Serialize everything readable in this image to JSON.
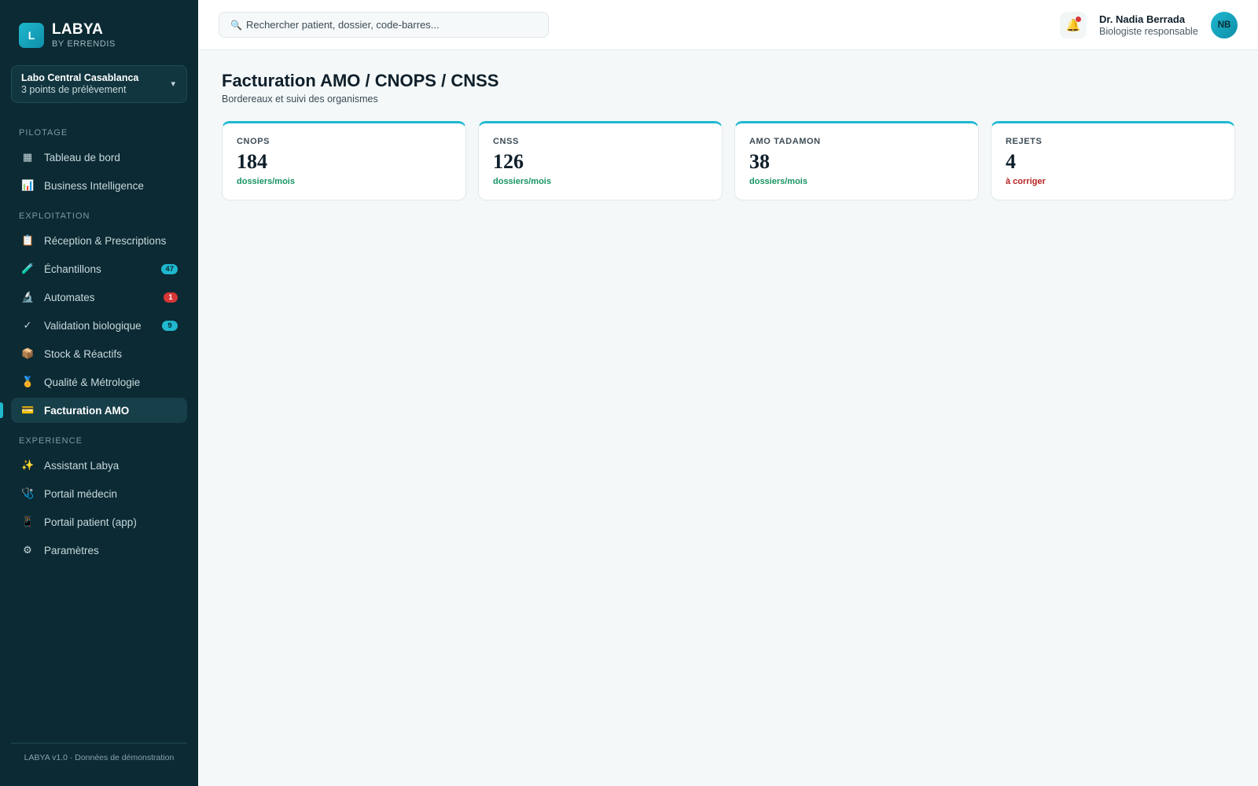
{
  "brand": {
    "logo_letter": "L",
    "name": "LABYA",
    "subtitle": "BY ERRENDIS"
  },
  "lab_selector": {
    "name": "Labo Central Casablanca",
    "subtitle": "3 points de prélèvement",
    "caret": "▾"
  },
  "sidebar": {
    "sections": [
      {
        "title": "PILOTAGE"
      },
      {
        "title": "EXPLOITATION"
      },
      {
        "title": "EXPERIENCE"
      }
    ],
    "items": [
      {
        "label": "Tableau de bord",
        "icon": "grid-icon",
        "glyph": "▦"
      },
      {
        "label": "Business Intelligence",
        "icon": "bar-chart-icon",
        "glyph": "📊"
      },
      {
        "label": "Réception & Prescriptions",
        "icon": "clipboard-icon",
        "glyph": "📋"
      },
      {
        "label": "Échantillons",
        "icon": "test-tube-icon",
        "glyph": "🧪",
        "badge": "47"
      },
      {
        "label": "Automates",
        "icon": "microscope-icon",
        "glyph": "🔬",
        "badge": "1"
      },
      {
        "label": "Validation biologique",
        "icon": "check-icon",
        "glyph": "✓",
        "badge": "9"
      },
      {
        "label": "Stock & Réactifs",
        "icon": "package-icon",
        "glyph": "📦"
      },
      {
        "label": "Qualité & Métrologie",
        "icon": "medal-icon",
        "glyph": "🏅"
      },
      {
        "label": "Facturation AMO",
        "icon": "credit-card-icon",
        "glyph": "💳",
        "active": true
      },
      {
        "label": "Assistant Labya",
        "icon": "sparkles-icon",
        "glyph": "✨"
      },
      {
        "label": "Portail médecin",
        "icon": "stethoscope-icon",
        "glyph": "🩺"
      },
      {
        "label": "Portail patient (app)",
        "icon": "mobile-phone-icon",
        "glyph": "📱"
      },
      {
        "label": "Paramètres",
        "icon": "gear-icon",
        "glyph": "⚙"
      }
    ],
    "footer": "LABYA v1.0 · Données de démonstration"
  },
  "topbar": {
    "search_icon": "🔍",
    "search_placeholder": "Rechercher patient, dossier, code-barres...",
    "bell_icon": "🔔",
    "user": {
      "name": "Dr. Nadia Berrada",
      "role": "Biologiste responsable",
      "initials": "NB"
    }
  },
  "page": {
    "title": "Facturation AMO / CNOPS / CNSS",
    "subtitle": "Bordereaux et suivi des organismes"
  },
  "cards": [
    {
      "label": "CNOPS",
      "value": "184",
      "note": "dossiers/mois"
    },
    {
      "label": "CNSS",
      "value": "126",
      "note": "dossiers/mois"
    },
    {
      "label": "AMO TADAMON",
      "value": "38",
      "note": "dossiers/mois"
    },
    {
      "label": "REJETS",
      "value": "4",
      "note": "à corriger"
    }
  ],
  "colors": {
    "sidebar_bg": "#0b2a33",
    "accent": "#1fb8cf",
    "positive": "#179463",
    "negative": "#b51f1f",
    "badge_alert": "#d93636"
  }
}
